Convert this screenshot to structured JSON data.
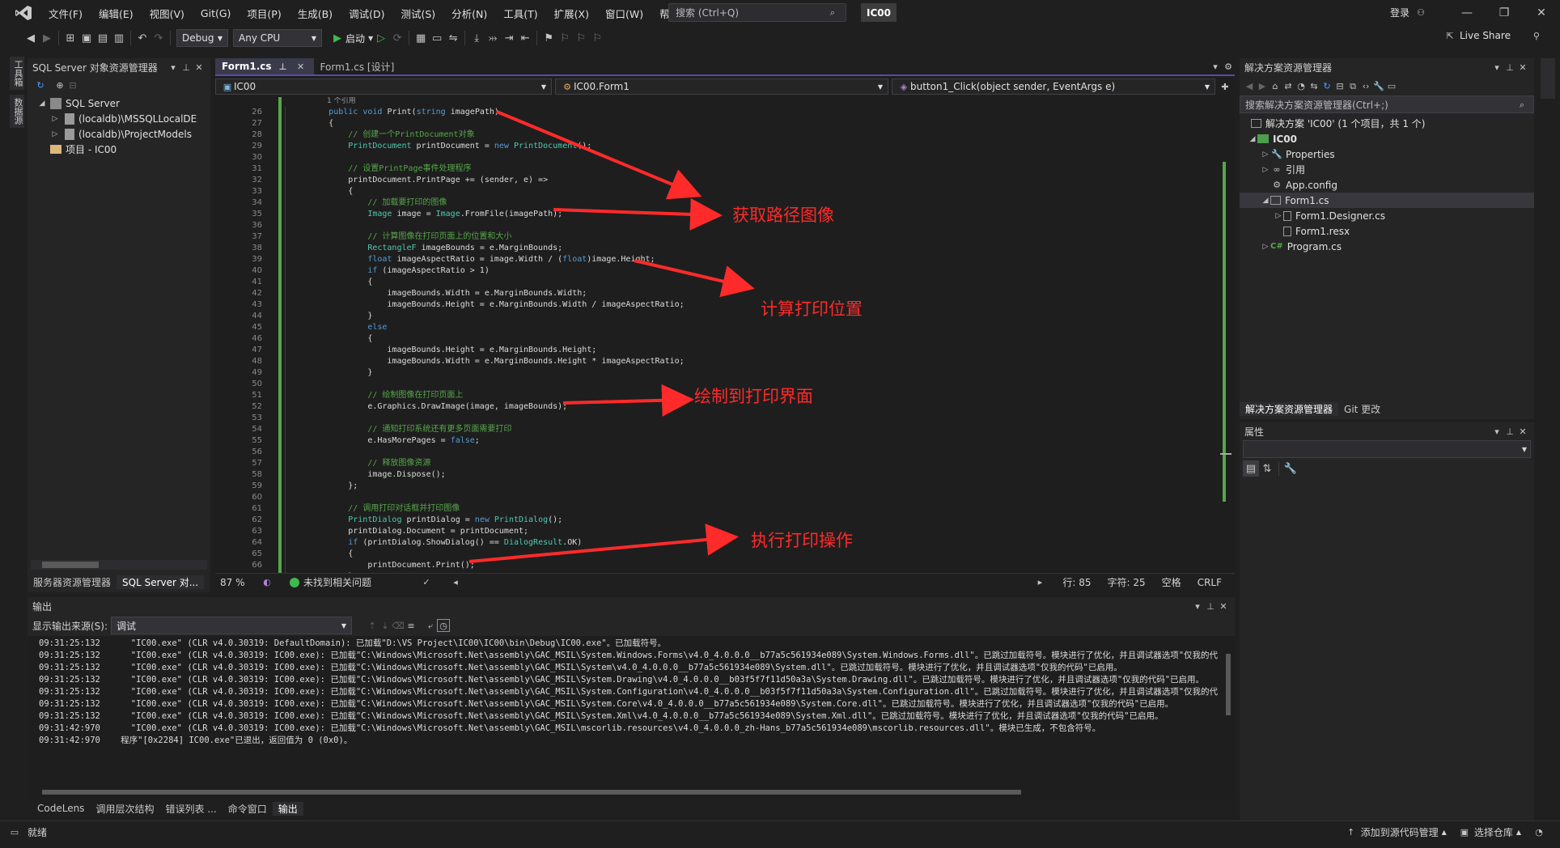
{
  "menu": [
    "文件(F)",
    "编辑(E)",
    "视图(V)",
    "Git(G)",
    "项目(P)",
    "生成(B)",
    "调试(D)",
    "测试(S)",
    "分析(N)",
    "工具(T)",
    "扩展(X)",
    "窗口(W)",
    "帮助(H)"
  ],
  "search": {
    "placeholder": "搜索 (Ctrl+Q)"
  },
  "solution_name": "IC00",
  "signin": "登录",
  "toolbar": {
    "config": "Debug",
    "platform": "Any CPU",
    "start": "启动",
    "liveshare": "Live Share"
  },
  "left_vtabs": [
    "工具箱",
    "数据源"
  ],
  "sql_explorer": {
    "title": "SQL Server 对象资源管理器",
    "tree": [
      {
        "label": "SQL Server",
        "level": 0
      },
      {
        "label": "(localdb)\\MSSQLLocalDE",
        "level": 1
      },
      {
        "label": "(localdb)\\ProjectModels",
        "level": 1
      },
      {
        "label": "项目 - IC00",
        "level": 0
      }
    ],
    "tabs": [
      "服务器资源管理器",
      "SQL Server 对..."
    ]
  },
  "editor": {
    "tabs": [
      {
        "label": "Form1.cs"
      },
      {
        "label": "Form1.cs [设计]"
      }
    ],
    "nav": {
      "project": "IC00",
      "class": "IC00.Form1",
      "member": "button1_Click(object sender, EventArgs e)"
    },
    "first_line": 26,
    "ref_hint": "1 个引用",
    "status": {
      "zoom": "87 %",
      "issues": "未找到相关问题",
      "line": "行: 85",
      "col": "字符: 25",
      "ws": "空格",
      "eol": "CRLF"
    }
  },
  "code_lines": [
    "        public void Print(string imagePath)",
    "        {",
    "            // 创建一个PrintDocument对象",
    "            PrintDocument printDocument = new PrintDocument();",
    "",
    "            // 设置PrintPage事件处理程序",
    "            printDocument.PrintPage += (sender, e) =>",
    "            {",
    "                // 加载要打印的图像",
    "                Image image = Image.FromFile(imagePath);",
    "",
    "                // 计算图像在打印页面上的位置和大小",
    "                RectangleF imageBounds = e.MarginBounds;",
    "                float imageAspectRatio = image.Width / (float)image.Height;",
    "                if (imageAspectRatio > 1)",
    "                {",
    "                    imageBounds.Width = e.MarginBounds.Width;",
    "                    imageBounds.Height = e.MarginBounds.Width / imageAspectRatio;",
    "                }",
    "                else",
    "                {",
    "                    imageBounds.Height = e.MarginBounds.Height;",
    "                    imageBounds.Width = e.MarginBounds.Height * imageAspectRatio;",
    "                }",
    "",
    "                // 绘制图像在打印页面上",
    "                e.Graphics.DrawImage(image, imageBounds);",
    "",
    "                // 通知打印系统还有更多页面需要打印",
    "                e.HasMorePages = false;",
    "",
    "                // 释放图像资源",
    "                image.Dispose();",
    "            };",
    "",
    "            // 调用打印对话框并打印图像",
    "            PrintDialog printDialog = new PrintDialog();",
    "            printDialog.Document = printDocument;",
    "            if (printDialog.ShowDialog() == DialogResult.OK)",
    "            {",
    "                printDocument.Print();",
    "            }"
  ],
  "annotations": [
    "获取路径图像",
    "计算打印位置",
    "绘制到打印界面",
    "执行打印操作"
  ],
  "solution_explorer": {
    "title": "解决方案资源管理器",
    "search_placeholder": "搜索解决方案资源管理器(Ctrl+;)",
    "tree": [
      {
        "label": "解决方案 'IC00' (1 个项目，共 1 个)",
        "level": 0
      },
      {
        "label": "IC00",
        "level": 1
      },
      {
        "label": "Properties",
        "level": 2
      },
      {
        "label": "引用",
        "level": 2
      },
      {
        "label": "App.config",
        "level": 2
      },
      {
        "label": "Form1.cs",
        "level": 2
      },
      {
        "label": "Form1.Designer.cs",
        "level": 3
      },
      {
        "label": "Form1.resx",
        "level": 3
      },
      {
        "label": "Program.cs",
        "level": 2
      }
    ],
    "tabs": [
      "解决方案资源管理器",
      "Git 更改"
    ]
  },
  "properties": {
    "title": "属性"
  },
  "output": {
    "title": "输出",
    "source_label": "显示输出来源(S):",
    "source_value": "调试",
    "lines": [
      "09:31:25:132      \"IC00.exe\" (CLR v4.0.30319: DefaultDomain): 已加载\"D:\\VS Project\\IC00\\IC00\\bin\\Debug\\IC00.exe\"。已加载符号。",
      "09:31:25:132      \"IC00.exe\" (CLR v4.0.30319: IC00.exe): 已加载\"C:\\Windows\\Microsoft.Net\\assembly\\GAC_MSIL\\System.Windows.Forms\\v4.0_4.0.0.0__b77a5c561934e089\\System.Windows.Forms.dll\"。已跳过加载符号。模块进行了优化，并且调试器选项\"仅我的代",
      "09:31:25:132      \"IC00.exe\" (CLR v4.0.30319: IC00.exe): 已加载\"C:\\Windows\\Microsoft.Net\\assembly\\GAC_MSIL\\System\\v4.0_4.0.0.0__b77a5c561934e089\\System.dll\"。已跳过加载符号。模块进行了优化，并且调试器选项\"仅我的代码\"已启用。",
      "09:31:25:132      \"IC00.exe\" (CLR v4.0.30319: IC00.exe): 已加载\"C:\\Windows\\Microsoft.Net\\assembly\\GAC_MSIL\\System.Drawing\\v4.0_4.0.0.0__b03f5f7f11d50a3a\\System.Drawing.dll\"。已跳过加载符号。模块进行了优化，并且调试器选项\"仅我的代码\"已启用。",
      "09:31:25:132      \"IC00.exe\" (CLR v4.0.30319: IC00.exe): 已加载\"C:\\Windows\\Microsoft.Net\\assembly\\GAC_MSIL\\System.Configuration\\v4.0_4.0.0.0__b03f5f7f11d50a3a\\System.Configuration.dll\"。已跳过加载符号。模块进行了优化，并且调试器选项\"仅我的代",
      "09:31:25:132      \"IC00.exe\" (CLR v4.0.30319: IC00.exe): 已加载\"C:\\Windows\\Microsoft.Net\\assembly\\GAC_MSIL\\System.Core\\v4.0_4.0.0.0__b77a5c561934e089\\System.Core.dll\"。已跳过加载符号。模块进行了优化，并且调试器选项\"仅我的代码\"已启用。",
      "09:31:25:132      \"IC00.exe\" (CLR v4.0.30319: IC00.exe): 已加载\"C:\\Windows\\Microsoft.Net\\assembly\\GAC_MSIL\\System.Xml\\v4.0_4.0.0.0__b77a5c561934e089\\System.Xml.dll\"。已跳过加载符号。模块进行了优化，并且调试器选项\"仅我的代码\"已启用。",
      "09:31:42:970      \"IC00.exe\" (CLR v4.0.30319: IC00.exe): 已加载\"C:\\Windows\\Microsoft.Net\\assembly\\GAC_MSIL\\mscorlib.resources\\v4.0_4.0.0.0_zh-Hans_b77a5c561934e089\\mscorlib.resources.dll\"。模块已生成，不包含符号。",
      "09:31:42:970    程序\"[0x2284] IC00.exe\"已退出，返回值为 0 (0x0)。"
    ],
    "tabs": [
      "CodeLens",
      "调用层次结构",
      "错误列表 ...",
      "命令窗口",
      "输出"
    ]
  },
  "statusbar": {
    "ready": "就绪",
    "source_control": "添加到源代码管理",
    "repo": "选择仓库"
  },
  "colors": {
    "accent": "#5a4aa8",
    "annotation": "#ff2a2a",
    "change_bar": "#57a64a"
  }
}
